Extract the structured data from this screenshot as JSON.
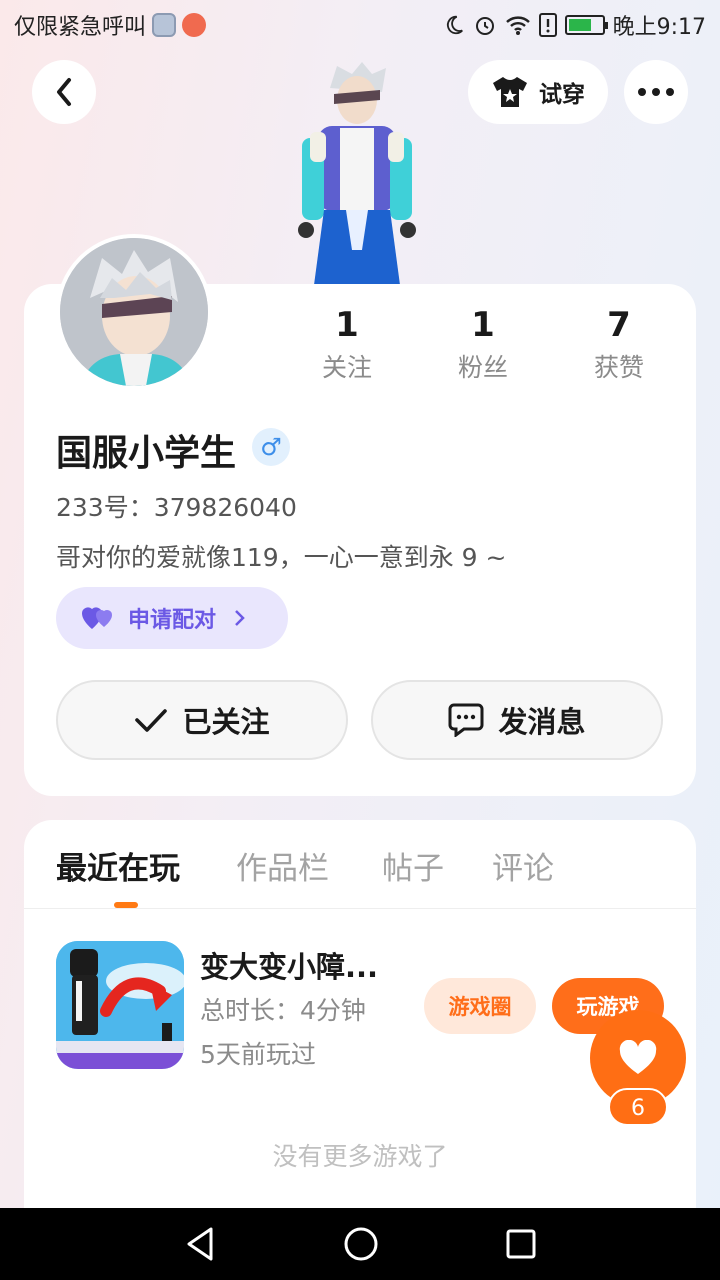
{
  "status_bar": {
    "carrier_text": "仅限紧急呼叫",
    "time": "晚上9:17"
  },
  "header": {
    "tryon_label": "试穿"
  },
  "stats": [
    {
      "value": "1",
      "label": "关注"
    },
    {
      "value": "1",
      "label": "粉丝"
    },
    {
      "value": "7",
      "label": "获赞"
    }
  ],
  "profile": {
    "name": "国服小学生",
    "gender_symbol": "♂",
    "id_text": "233号：379826040",
    "bio": "哥对你的爱就像119，一心一意到永 9 ~",
    "pair_label": "申请配对"
  },
  "actions": {
    "follow_label": "已关注",
    "message_label": "发消息"
  },
  "tabs": [
    "最近在玩",
    "作品栏",
    "帖子",
    "评论"
  ],
  "game": {
    "title": "变大变小障...",
    "duration": "总时长：4分钟",
    "last_played": "5天前玩过",
    "circle_label": "游戏圈",
    "play_label": "玩游戏"
  },
  "footer_note": "没有更多游戏了",
  "like": {
    "count": "6"
  },
  "colors": {
    "accent": "#ff6e14",
    "pair": "#6b59e5",
    "gender": "#3d8ee9"
  },
  "icons": [
    "back-icon",
    "tshirt-icon",
    "more-icon",
    "heart-pair-icon",
    "chevron-right-icon",
    "check-icon",
    "chat-icon",
    "heart-icon",
    "nav-back-icon",
    "nav-home-icon",
    "nav-recents-icon"
  ]
}
